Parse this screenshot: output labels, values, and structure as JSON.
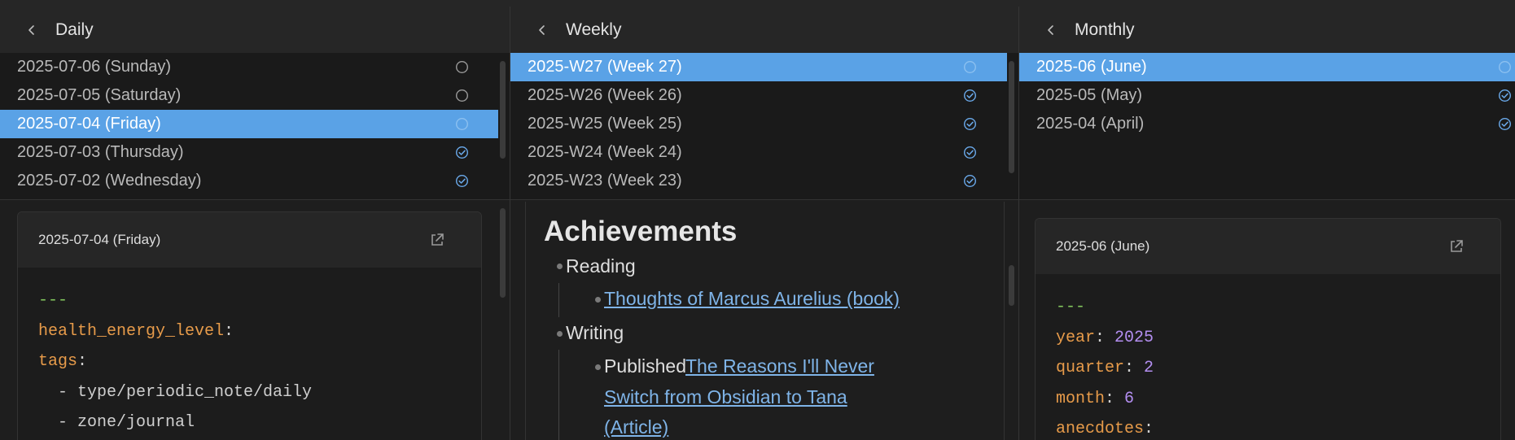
{
  "daily": {
    "title": "Daily",
    "items": [
      {
        "label": "2025-07-06 (Sunday)",
        "status": "open"
      },
      {
        "label": "2025-07-05 (Saturday)",
        "status": "open"
      },
      {
        "label": "2025-07-04 (Friday)",
        "status": "open",
        "selected": true
      },
      {
        "label": "2025-07-03 (Thursday)",
        "status": "done"
      },
      {
        "label": "2025-07-02 (Wednesday)",
        "status": "done"
      }
    ],
    "preview": {
      "title": "2025-07-04 (Friday)",
      "lines": {
        "dashes": "---",
        "key1": "health_energy_level",
        "key2": "tags",
        "tag1": "  - type/periodic_note/daily",
        "tag2": "  - zone/journal"
      }
    }
  },
  "weekly": {
    "title": "Weekly",
    "items": [
      {
        "label": "2025-W27 (Week 27)",
        "status": "open",
        "selected": true
      },
      {
        "label": "2025-W26 (Week 26)",
        "status": "done"
      },
      {
        "label": "2025-W25 (Week 25)",
        "status": "done"
      },
      {
        "label": "2025-W24 (Week 24)",
        "status": "done"
      },
      {
        "label": "2025-W23 (Week 23)",
        "status": "done"
      }
    ],
    "note": {
      "heading": "Achievements",
      "reading": "Reading",
      "reading_link": "Thoughts of Marcus Aurelius (book)",
      "writing": "Writing",
      "published": "Published",
      "writing_link_1": "The Reasons I'll Never",
      "writing_link_2": "Switch from Obsidian to Tana",
      "writing_link_3": "(Article)"
    }
  },
  "monthly": {
    "title": "Monthly",
    "items": [
      {
        "label": "2025-06 (June)",
        "status": "open",
        "selected": true
      },
      {
        "label": "2025-05 (May)",
        "status": "done"
      },
      {
        "label": "2025-04 (April)",
        "status": "done"
      }
    ],
    "preview": {
      "title": "2025-06 (June)",
      "lines": {
        "dashes": "---",
        "year_key": "year",
        "year_val": "2025",
        "quarter_key": "quarter",
        "quarter_val": "2",
        "month_key": "month",
        "month_val": "6",
        "anecdotes_key": "anecdotes"
      }
    }
  },
  "colors": {
    "selected": "#5aa2e6",
    "done_check": "#6aa9ea",
    "link": "#7fb4e8",
    "yaml_key": "#e79b4a",
    "yaml_number": "#b38ef0",
    "yaml_dashes": "#83c85e"
  },
  "icons": {
    "back": "chevron-left-icon",
    "open_status": "circle-icon",
    "done_status": "check-circle-icon",
    "open_in_new": "external-link-icon"
  }
}
